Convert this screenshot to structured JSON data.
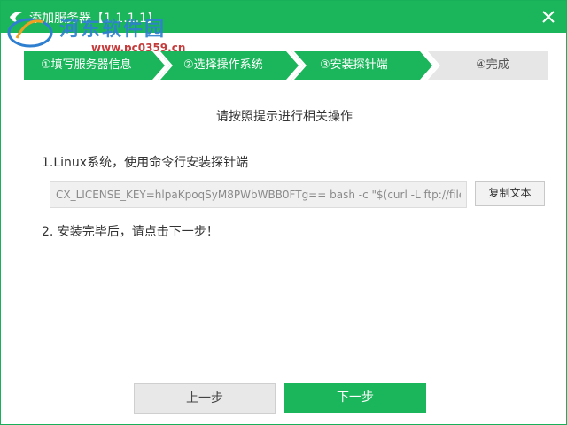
{
  "window": {
    "title": "添加服务器【1.1.1.1】"
  },
  "watermark": {
    "text": "河东软件园",
    "url": "www.pc0359.cn"
  },
  "steps": [
    {
      "label": "①填写服务器信息",
      "state": "done"
    },
    {
      "label": "②选择操作系统",
      "state": "done"
    },
    {
      "label": "③安装探针端",
      "state": "active"
    },
    {
      "label": "④完成",
      "state": "pending"
    }
  ],
  "main": {
    "instruction": "请按照提示进行相关操作",
    "step1_text": "1.Linux系统，使用命令行安装探针端",
    "command_value": "CX_LICENSE_KEY=hlpaKpoqSyM8PWbWBB0FTg== bash -c \"$(curl -L ftp://file.clo",
    "copy_button": "复制文本",
    "step2_text": "2. 安装完毕后，请点击下一步！"
  },
  "footer": {
    "prev_button": "上一步",
    "next_button": "下一步"
  },
  "colors": {
    "accent": "#1bb65b",
    "step_pending": "#e6e6e6"
  },
  "icons": {
    "title_icon": "app-logo-icon",
    "close": "close-icon"
  }
}
